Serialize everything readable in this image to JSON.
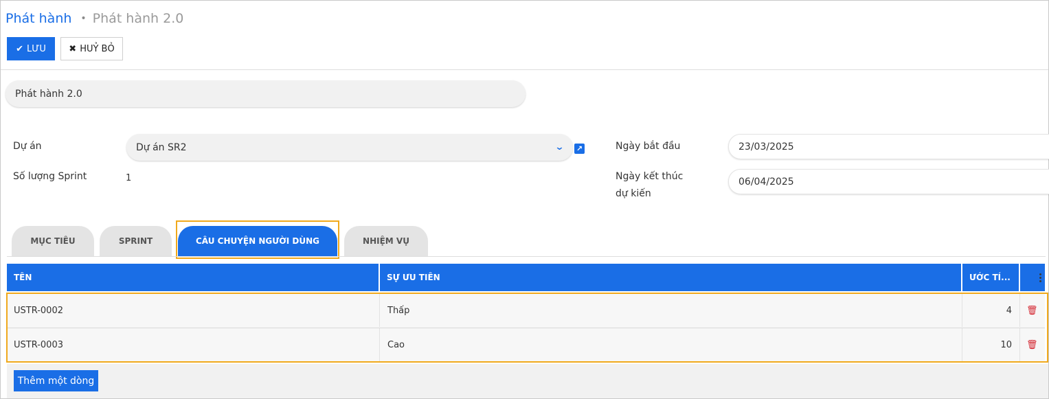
{
  "breadcrumb": {
    "root": "Phát hành",
    "separator": "•",
    "current": "Phát hành 2.0"
  },
  "toolbar": {
    "save_label": "LƯU",
    "save_icon": "check-icon",
    "cancel_label": "HUỶ BỎ",
    "cancel_icon": "x-icon"
  },
  "form": {
    "name_value": "Phát hành 2.0",
    "project_label": "Dự án",
    "project_value": "Dự án SR2",
    "sprint_count_label": "Số lượng Sprint",
    "sprint_count_value": "1",
    "start_date_label": "Ngày bắt đầu",
    "start_date_value": "23/03/2025",
    "end_date_label_line1": "Ngày kết thúc",
    "end_date_label_line2": "dự kiến",
    "end_date_value": "06/04/2025"
  },
  "tabs": [
    {
      "label": "MỤC TIÊU",
      "active": false
    },
    {
      "label": "SPRINT",
      "active": false
    },
    {
      "label": "CÂU CHUYỆN NGƯỜI DÙNG",
      "active": true
    },
    {
      "label": "NHIỆM VỤ",
      "active": false
    }
  ],
  "table": {
    "columns": [
      "TÊN",
      "SỰ ƯU TIÊN",
      "ƯỚC TÍ..."
    ],
    "rows": [
      {
        "name": "USTR-0002",
        "priority": "Thấp",
        "estimate": "4"
      },
      {
        "name": "USTR-0003",
        "priority": "Cao",
        "estimate": "10"
      }
    ],
    "add_row_label": "Thêm một dòng"
  },
  "colors": {
    "primary": "#1a6ee6",
    "highlight": "#f0a91c",
    "delete": "#d3232e"
  }
}
